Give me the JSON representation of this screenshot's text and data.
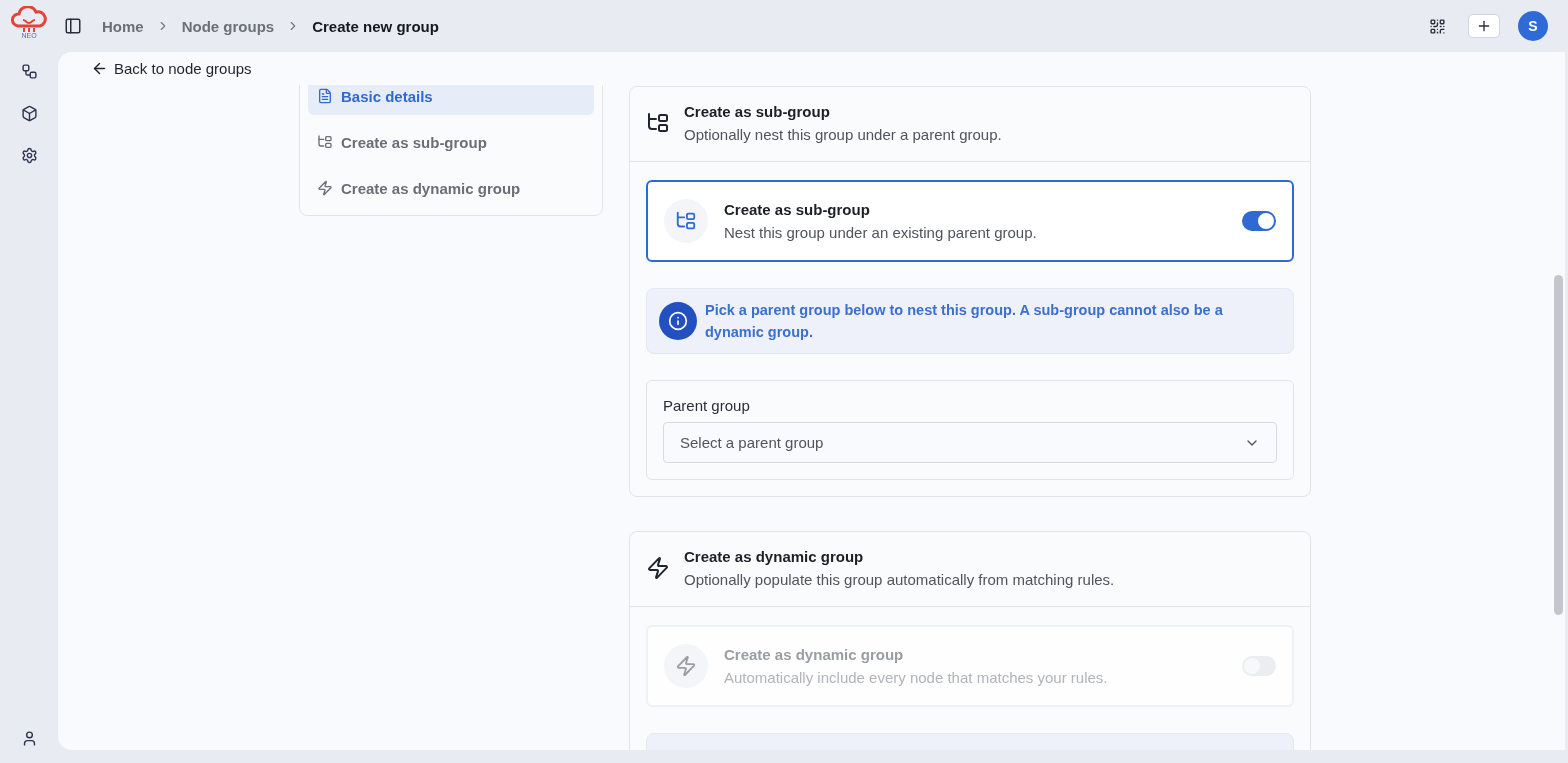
{
  "logo": {
    "text": "NEO"
  },
  "breadcrumbs": [
    {
      "label": "Home",
      "current": false
    },
    {
      "label": "Node groups",
      "current": false
    },
    {
      "label": "Create new group",
      "current": true
    }
  ],
  "user": {
    "initial": "S"
  },
  "back_link": "Back to node groups",
  "nav": [
    {
      "label": "Basic details",
      "selected": true,
      "kind": "doc"
    },
    {
      "label": "Create as sub-group",
      "selected": false,
      "kind": "tree"
    },
    {
      "label": "Create as dynamic group",
      "selected": false,
      "kind": "bolt"
    }
  ],
  "sections": [
    {
      "kind": "tree",
      "title": "Create as sub-group",
      "subtitle": "Optionally nest this group under a parent group.",
      "toggle": {
        "title": "Create as sub-group",
        "description": "Nest this group under an existing parent group.",
        "on": true,
        "disabled": false
      },
      "info": "Pick a parent group below to nest this group. A sub-group cannot also be a dynamic group.",
      "field": {
        "label": "Parent group",
        "placeholder": "Select a parent group"
      }
    },
    {
      "kind": "bolt",
      "title": "Create as dynamic group",
      "subtitle": "Optionally populate this group automatically from matching rules.",
      "toggle": {
        "title": "Create as dynamic group",
        "description": "Automatically include every node that matches your rules.",
        "on": false,
        "disabled": true
      }
    }
  ]
}
